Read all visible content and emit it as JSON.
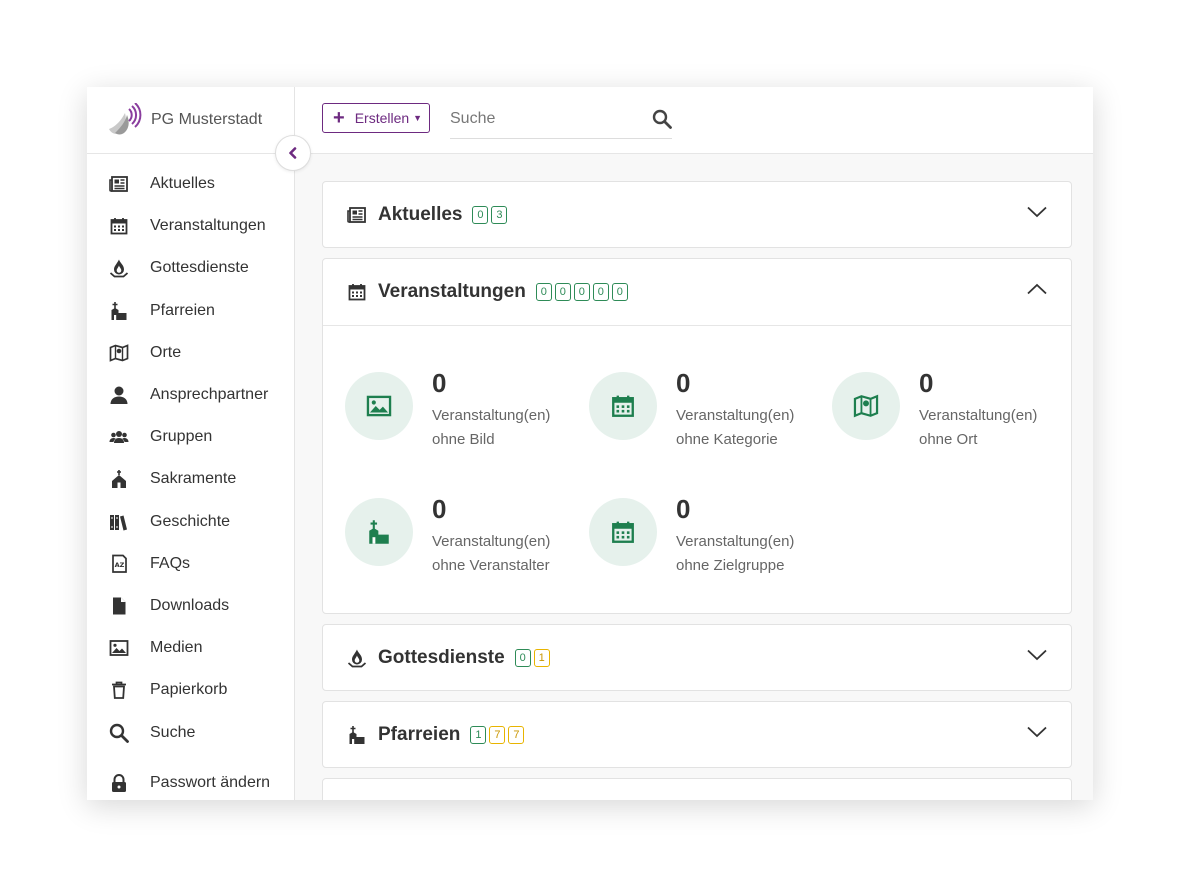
{
  "brand": {
    "name": "PG Musterstadt"
  },
  "topbar": {
    "create_label": "Erstellen",
    "search_placeholder": "Suche"
  },
  "sidebar": {
    "items": [
      {
        "label": "Aktuelles",
        "icon": "newspaper-icon"
      },
      {
        "label": "Veranstaltungen",
        "icon": "calendar-icon"
      },
      {
        "label": "Gottesdienste",
        "icon": "flame-icon"
      },
      {
        "label": "Pfarreien",
        "icon": "church-icon"
      },
      {
        "label": "Orte",
        "icon": "map-icon"
      },
      {
        "label": "Ansprechpartner",
        "icon": "user-icon"
      },
      {
        "label": "Gruppen",
        "icon": "users-icon"
      },
      {
        "label": "Sakramente",
        "icon": "chapel-icon"
      },
      {
        "label": "Geschichte",
        "icon": "books-icon"
      },
      {
        "label": "FAQs",
        "icon": "faq-icon"
      },
      {
        "label": "Downloads",
        "icon": "file-icon"
      },
      {
        "label": "Medien",
        "icon": "image-icon"
      },
      {
        "label": "Papierkorb",
        "icon": "trash-icon"
      },
      {
        "label": "Suche",
        "icon": "search-icon"
      }
    ],
    "bottom_item": {
      "label": "Passwort ändern",
      "icon": "lock-icon"
    }
  },
  "sections": {
    "aktuelles": {
      "title": "Aktuelles",
      "badges": [
        "0",
        "3"
      ],
      "expanded": false
    },
    "veranstaltungen": {
      "title": "Veranstaltungen",
      "badges": [
        "0",
        "0",
        "0",
        "0",
        "0"
      ],
      "expanded": true,
      "stats": [
        {
          "value": "0",
          "line1": "Veranstaltung(en)",
          "line2": "ohne Bild",
          "icon": "image-icon"
        },
        {
          "value": "0",
          "line1": "Veranstaltung(en)",
          "line2": "ohne Kategorie",
          "icon": "calendar-icon"
        },
        {
          "value": "0",
          "line1": "Veranstaltung(en)",
          "line2": "ohne Ort",
          "icon": "map-pin-icon"
        },
        {
          "value": "0",
          "line1": "Veranstaltung(en)",
          "line2": "ohne Veranstalter",
          "icon": "church-icon"
        },
        {
          "value": "0",
          "line1": "Veranstaltung(en)",
          "line2": "ohne Zielgruppe",
          "icon": "calendar-icon"
        }
      ]
    },
    "gottesdienste": {
      "title": "Gottesdienste",
      "badges": [
        "0",
        "1"
      ],
      "expanded": false
    },
    "pfarreien": {
      "title": "Pfarreien",
      "badges": [
        "1",
        "7",
        "7"
      ],
      "expanded": false
    }
  },
  "colors": {
    "accent": "#6d2a80",
    "green": "#1e7f4f",
    "badge_green": "#2e8b57",
    "badge_yellow": "#e8b400",
    "stat_circle": "#e6f1ec"
  }
}
